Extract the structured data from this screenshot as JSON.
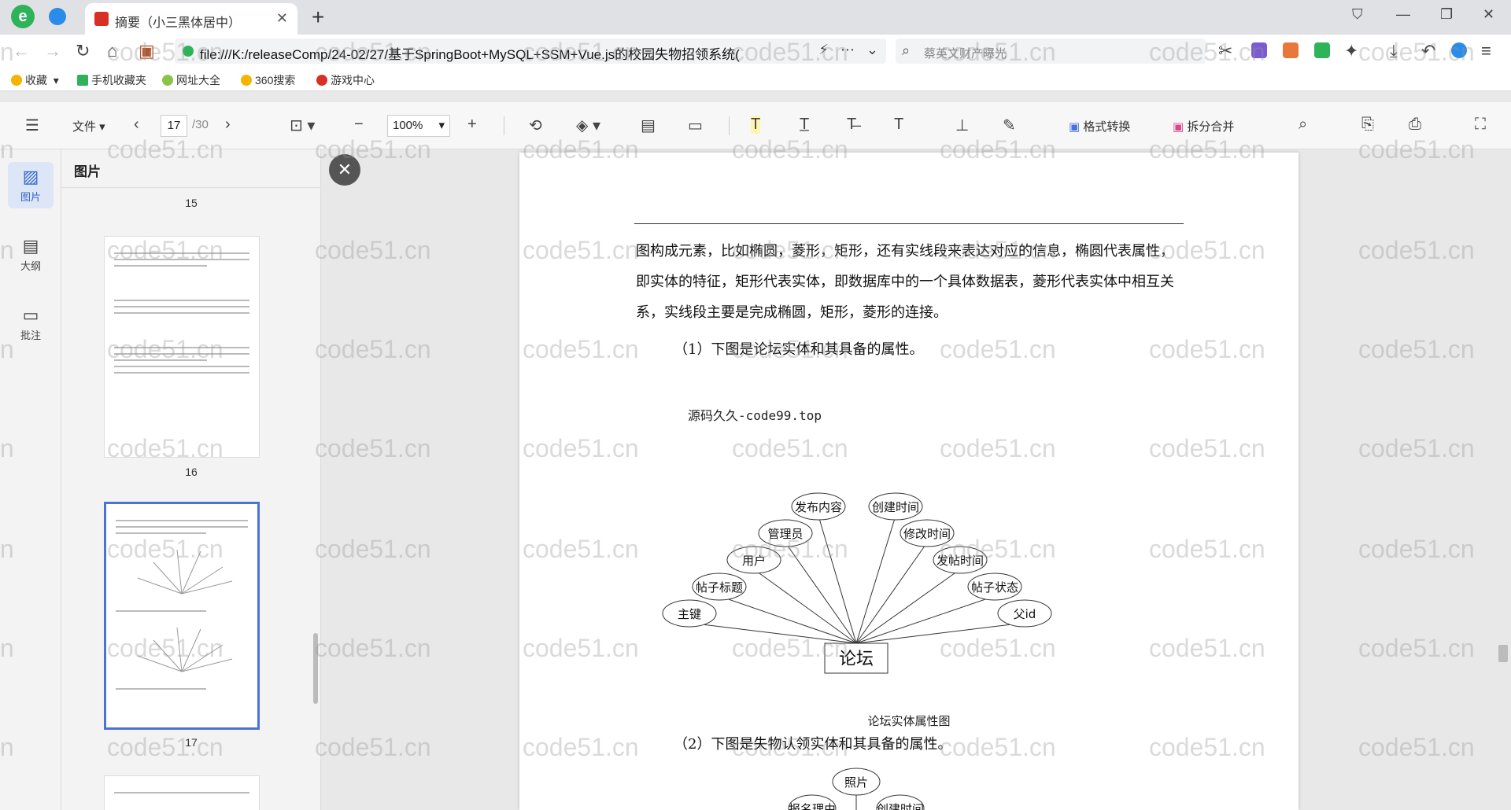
{
  "browser": {
    "tab_title": "摘要（小三黑体居中）",
    "url": "file:///K:/releaseComp/24-02/27/基于SpringBoot+MySQL+SSM+Vue.js的校园失物招领系统(",
    "search_placeholder": "蔡英文财产曝光",
    "bookmarks": [
      "收藏",
      "手机收藏夹",
      "网址大全",
      "360搜索",
      "游戏中心"
    ]
  },
  "toolbar": {
    "file_label": "文件",
    "current_page": "17",
    "total_pages": "/30",
    "zoom": "100%",
    "convert_label": "格式转换",
    "split_merge_label": "拆分合并"
  },
  "sidebar": {
    "rail": [
      {
        "label": "图片",
        "icon": "image-icon",
        "active": true
      },
      {
        "label": "大纲",
        "icon": "outline-icon",
        "active": false
      },
      {
        "label": "批注",
        "icon": "comment-icon",
        "active": false
      }
    ],
    "panel_title": "图片",
    "thumbs": [
      {
        "num": "15"
      },
      {
        "num": "16"
      },
      {
        "num": "17",
        "selected": true
      }
    ]
  },
  "document": {
    "paragraph": "图构成元素，比如椭圆，菱形，矩形，还有实线段来表达对应的信息，椭圆代表属性，即实体的特征，矩形代表实体，即数据库中的一个具体数据表，菱形代表实体中相互关系，实线段主要是完成椭圆，矩形，菱形的连接。",
    "item1": "（1）下图是论坛实体和其具备的属性。",
    "diagram_watermark": "源码久久-code99.top",
    "er1": {
      "entity": "论坛",
      "attributes": [
        "主键",
        "帖子标题",
        "用户",
        "管理员",
        "发布内容",
        "创建时间",
        "修改时间",
        "发帖时间",
        "帖子状态",
        "父id"
      ]
    },
    "caption1": "论坛实体属性图",
    "item2": "（2）下图是失物认领实体和其具备的属性。",
    "er2_attributes": [
      "照片",
      "报名理由",
      "创建时间"
    ]
  },
  "watermark_text": "code51.cn"
}
